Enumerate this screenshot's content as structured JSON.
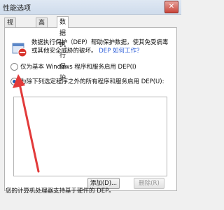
{
  "window": {
    "title": "性能选项",
    "close_glyph": "✕"
  },
  "tabs": [
    {
      "label": "视觉效果",
      "active": false
    },
    {
      "label": "高级",
      "active": false
    },
    {
      "label": "数据执行保护",
      "active": true
    }
  ],
  "dep": {
    "description": "数据执行保护（DEP）帮助保护数据，使其免受病毒或其他安全威胁的破坏。",
    "description_link": "DEP 如何工作？",
    "option1_label": "仅为基本 Windows 程序和服务启用 DEP(I)",
    "option2_label": "为除下列选定程序之外的所有程序和服务启用 DEP(U):",
    "selected_option": 2,
    "add_button": "添加(D)...",
    "remove_button": "删除(R)",
    "footer": "您的计算机处理器支持基于硬件的 DEP。"
  },
  "annotation": {
    "arrow_color": "#e23a3a"
  },
  "icons": {
    "shield": "shield-icon",
    "arrow": "red-arrow"
  }
}
